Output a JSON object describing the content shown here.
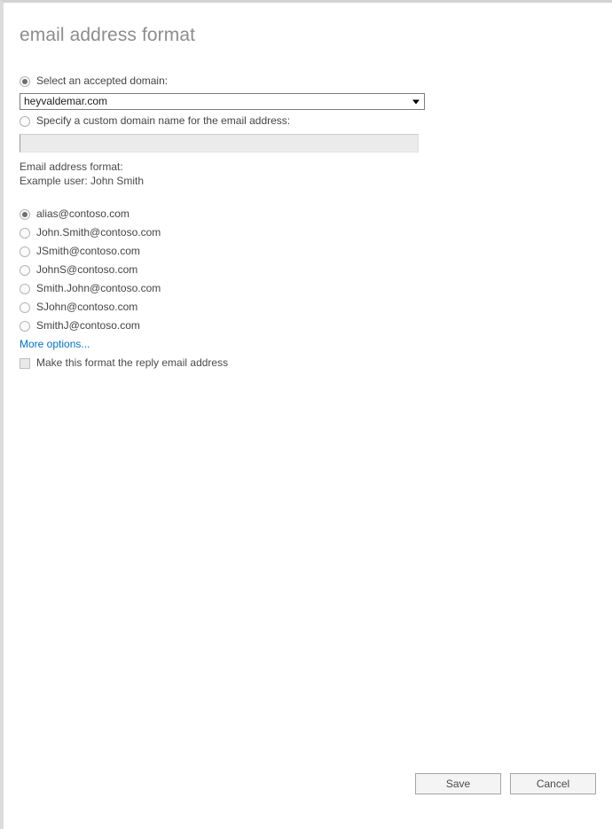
{
  "dialog": {
    "title": "email address format"
  },
  "domain_section": {
    "accepted_domain": {
      "label": "Select an accepted domain:",
      "selected": true,
      "value": "heyvaldemar.com",
      "arrow_icon": "chevron-down-icon"
    },
    "custom_domain": {
      "label": "Specify a custom domain name for the email address:",
      "selected": false,
      "value": "",
      "placeholder": "",
      "disabled": true
    }
  },
  "format_info": {
    "format_label": "Email address format:",
    "example_label": "Example user: John Smith"
  },
  "format_options": {
    "selected_index": 0,
    "items": [
      {
        "label": "alias@contoso.com",
        "selected": true
      },
      {
        "label": "John.Smith@contoso.com",
        "selected": false
      },
      {
        "label": "JSmith@contoso.com",
        "selected": false
      },
      {
        "label": "JohnS@contoso.com",
        "selected": false
      },
      {
        "label": "Smith.John@contoso.com",
        "selected": false
      },
      {
        "label": "SJohn@contoso.com",
        "selected": false
      },
      {
        "label": "SmithJ@contoso.com",
        "selected": false
      }
    ],
    "more_options_link": "More options...",
    "reply_checkbox": {
      "label": "Make this format the reply email address",
      "checked": false
    }
  },
  "footer": {
    "save_label": "Save",
    "cancel_label": "Cancel"
  },
  "colors": {
    "link": "#0072c6",
    "title": "#8d8d8d",
    "text": "#444444",
    "border": "#a5a5a5",
    "disabled_fill": "#ebebeb"
  }
}
